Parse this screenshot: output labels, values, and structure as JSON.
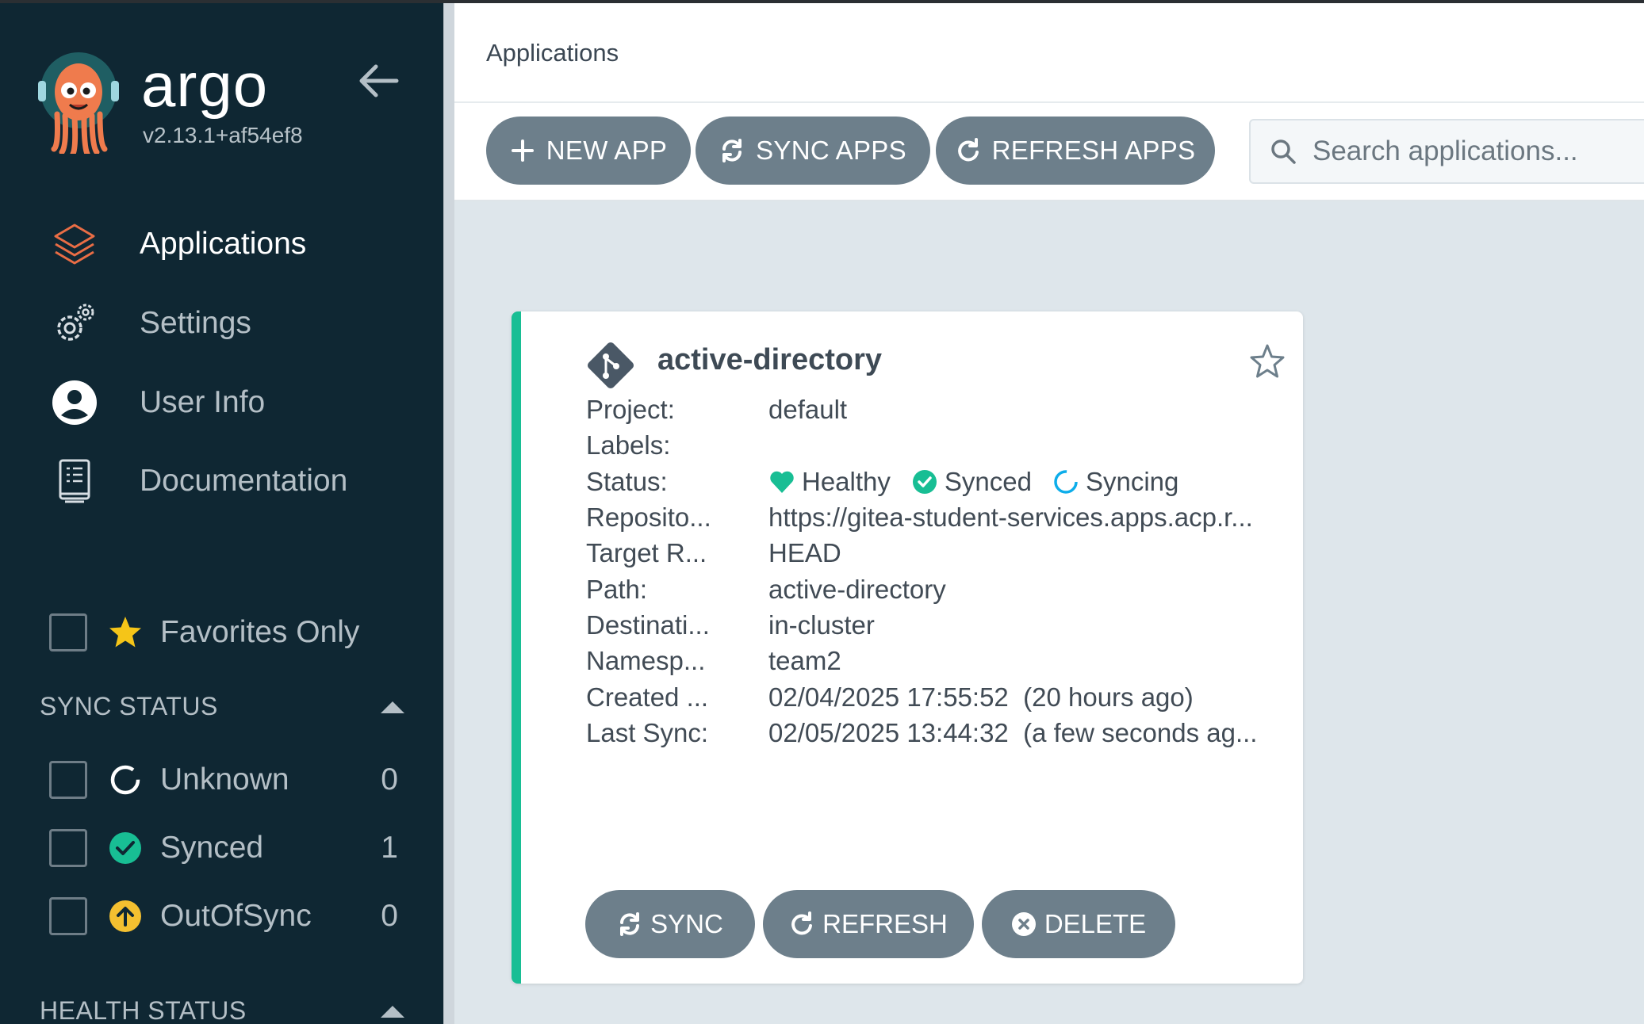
{
  "app": {
    "name": "argo",
    "version": "v2.13.1+af54ef8"
  },
  "nav": {
    "items": [
      {
        "label": "Applications",
        "icon": "stack-icon",
        "active": true
      },
      {
        "label": "Settings",
        "icon": "gears-icon",
        "active": false
      },
      {
        "label": "User Info",
        "icon": "user-circle-icon",
        "active": false
      },
      {
        "label": "Documentation",
        "icon": "book-icon",
        "active": false
      }
    ]
  },
  "filters": {
    "favorites_label": "Favorites Only",
    "sync_status_title": "SYNC STATUS",
    "sync_status": [
      {
        "label": "Unknown",
        "count": "0",
        "icon": "circle-outline-icon"
      },
      {
        "label": "Synced",
        "count": "1",
        "icon": "check-circle-icon"
      },
      {
        "label": "OutOfSync",
        "count": "0",
        "icon": "arrow-up-circle-icon"
      }
    ],
    "health_status_title": "HEALTH STATUS"
  },
  "header": {
    "title": "Applications"
  },
  "toolbar": {
    "new_app": "NEW APP",
    "sync_apps": "SYNC APPS",
    "refresh_apps": "REFRESH APPS",
    "search_placeholder": "Search applications..."
  },
  "card": {
    "name": "active-directory",
    "fields": {
      "project_key": "Project:",
      "project_val": "default",
      "labels_key": "Labels:",
      "labels_val": "",
      "status_key": "Status:",
      "health": "Healthy",
      "sync": "Synced",
      "operation": "Syncing",
      "repo_key": "Reposito...",
      "repo_val": "https://gitea-student-services.apps.acp.r...",
      "target_key": "Target R...",
      "target_val": "HEAD",
      "path_key": "Path:",
      "path_val": "active-directory",
      "dest_key": "Destinati...",
      "dest_val": "in-cluster",
      "ns_key": "Namesp...",
      "ns_val": "team2",
      "created_key": "Created ...",
      "created_val": "02/04/2025 17:55:52  (20 hours ago)",
      "lastsync_key": "Last Sync:",
      "lastsync_val": "02/05/2025 13:44:32  (a few seconds ag..."
    },
    "buttons": {
      "sync": "SYNC",
      "refresh": "REFRESH",
      "delete": "DELETE"
    }
  },
  "colors": {
    "sidebar_bg": "#0f2733",
    "accent_green": "#18be94",
    "button_gray": "#6d7f8b",
    "healthy": "#18be94",
    "syncing": "#0dadea",
    "outofsync": "#f4c030",
    "nav_active_icon": "#e96d45"
  }
}
